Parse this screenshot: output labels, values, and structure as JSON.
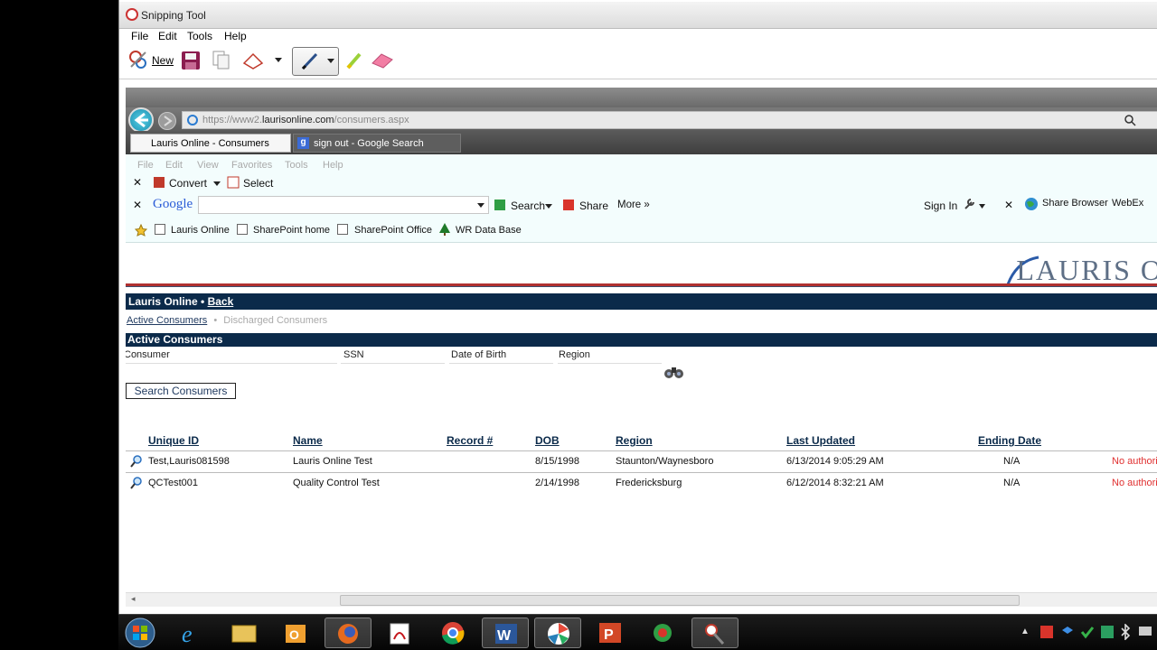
{
  "snipping_tool": {
    "title": "Snipping Tool",
    "menu": [
      "File",
      "Edit",
      "Tools",
      "Help"
    ],
    "new_label": "New"
  },
  "browser": {
    "url_prefix": "https://www2.",
    "url_domain": "laurisonline.com",
    "url_path": "/consumers.aspx",
    "tabs": [
      "Lauris Online - Consumers",
      "sign out - Google Search"
    ],
    "menu": [
      "File",
      "Edit",
      "View",
      "Favorites",
      "Tools",
      "Help"
    ],
    "convert_label": "Convert",
    "select_label": "Select",
    "google_logo": "Google",
    "search_label": "Search",
    "share_label": "Share",
    "more_label": "More »",
    "sign_in_label": "Sign In",
    "share_browser_label": "Share Browser",
    "webex_label": "WebEx",
    "favorites": [
      "Lauris Online",
      "SharePoint home",
      "SharePoint Office",
      "WR Data Base"
    ]
  },
  "page": {
    "logo": "LAURIS O",
    "nav_title": "Lauris Online",
    "nav_sep": " • ",
    "nav_back": "Back",
    "subnav_active": "Active Consumers",
    "subnav_sep": "•",
    "subnav_inactive": "Discharged Consumers",
    "section_title": "Active Consumers",
    "filters": {
      "consumer": "Consumer",
      "ssn": "SSN",
      "dob": "Date of Birth",
      "region": "Region"
    },
    "search_button": "Search Consumers",
    "table": {
      "headers": [
        "Unique ID",
        "Name",
        "Record #",
        "DOB",
        "Region",
        "Last Updated",
        "Ending Date"
      ],
      "rows": [
        {
          "id": "Test,Lauris081598",
          "name": "Lauris Online Test",
          "record": "",
          "dob": "8/15/1998",
          "region": "Staunton/Waynesboro",
          "updated": "6/13/2014 9:05:29 AM",
          "ending": "N/A",
          "auth": "No authori"
        },
        {
          "id": "QCTest001",
          "name": "Quality Control Test",
          "record": "",
          "dob": "2/14/1998",
          "region": "Fredericksburg",
          "updated": "6/12/2014 8:32:21 AM",
          "ending": "N/A",
          "auth": "No authori"
        }
      ]
    }
  },
  "colors": {
    "nav_bg": "#0b2a4a",
    "accent_red": "#b03030",
    "auth_red": "#e03030"
  }
}
